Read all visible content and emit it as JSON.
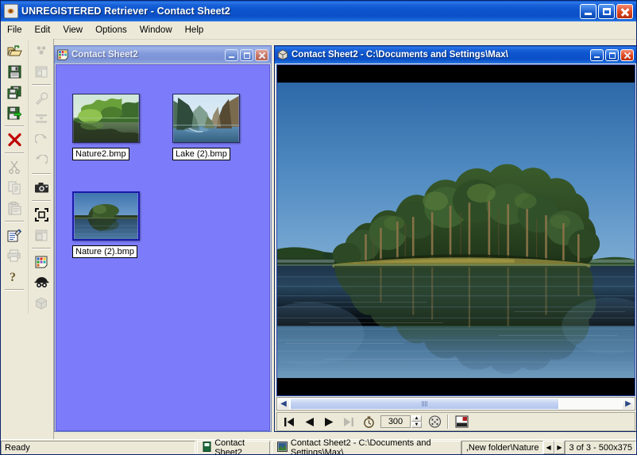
{
  "window": {
    "title": "UNREGISTERED Retriever - Contact Sheet2",
    "app_icon": "camera-lens-icon",
    "minimize_label": "Minimize",
    "maximize_label": "Maximize",
    "close_label": "Close"
  },
  "menu": {
    "items": [
      {
        "label": "File"
      },
      {
        "label": "Edit"
      },
      {
        "label": "View"
      },
      {
        "label": "Options"
      },
      {
        "label": "Window"
      },
      {
        "label": "Help"
      }
    ]
  },
  "toolbar_left": {
    "column1": [
      {
        "name": "open-folder-icon",
        "label": "Open",
        "enabled": true
      },
      {
        "name": "save-icon",
        "label": "Save",
        "enabled": true
      },
      {
        "name": "save-all-icon",
        "label": "Save All",
        "enabled": true
      },
      {
        "name": "save-export-icon",
        "label": "Export",
        "enabled": true
      },
      {
        "name": "delete-icon",
        "label": "Delete",
        "enabled": true
      },
      {
        "name": "cut-icon",
        "label": "Cut",
        "enabled": false
      },
      {
        "name": "copy-icon",
        "label": "Copy",
        "enabled": false
      },
      {
        "name": "paste-icon",
        "label": "Paste",
        "enabled": false
      },
      {
        "name": "properties-icon",
        "label": "Properties",
        "enabled": true
      },
      {
        "name": "print-icon",
        "label": "Print",
        "enabled": false
      },
      {
        "name": "help-icon",
        "label": "Help",
        "enabled": true
      }
    ],
    "column2": [
      {
        "name": "color-palette-icon",
        "label": "Colors",
        "enabled": false
      },
      {
        "name": "window-tile-icon",
        "label": "Tile Windows",
        "enabled": false
      },
      {
        "name": "wrench-icon",
        "label": "Tools",
        "enabled": false
      },
      {
        "name": "sort-icon",
        "label": "Sort",
        "enabled": false
      },
      {
        "name": "redo-icon",
        "label": "Redo",
        "enabled": false
      },
      {
        "name": "undo-icon",
        "label": "Undo",
        "enabled": false
      },
      {
        "name": "camera-icon",
        "label": "Capture",
        "enabled": true
      },
      {
        "name": "fullscreen-icon",
        "label": "Full Screen",
        "enabled": true
      },
      {
        "name": "cascade-windows-icon",
        "label": "Cascade",
        "enabled": false
      },
      {
        "name": "contact-sheet-icon",
        "label": "Contact Sheet",
        "enabled": true
      },
      {
        "name": "detective-icon",
        "label": "Find",
        "enabled": true
      },
      {
        "name": "cube-icon",
        "label": "3D",
        "enabled": false
      }
    ]
  },
  "contact_sheet_window": {
    "title": "Contact Sheet2",
    "icon": "contact-sheet-icon",
    "background_color": "#7c7cfb",
    "thumbnails": [
      {
        "caption": "Nature2.bmp",
        "selected": false,
        "scene": "river-forest"
      },
      {
        "caption": "Lake (2).bmp",
        "selected": false,
        "scene": "fjord-cliffs"
      },
      {
        "caption": "Nature (2).bmp",
        "selected": true,
        "scene": "lake-island"
      }
    ]
  },
  "image_window": {
    "title": "Contact Sheet2 - C:\\Documents and Settings\\Max\\",
    "icon": "cube-icon",
    "photo_alt": "lake-island-with-pine-trees-reflection",
    "scrollbar": {
      "left_arrow": "◀",
      "right_arrow": "▶",
      "thumb_position_percent": 0
    },
    "nav_toolbar": {
      "first_label": "First",
      "prev_label": "Previous",
      "next_label": "Next",
      "last_label": "Last",
      "timer_label": "Slideshow Timer",
      "interval_value": "300",
      "spin_up": "▲",
      "spin_down": "▼",
      "dice_label": "Random",
      "thumbnail_label": "Thumbnail View"
    }
  },
  "statusbar": {
    "ready_text": "Ready",
    "tasks": [
      {
        "label": "Contact Sheet2",
        "icon": "contact-sheet-icon"
      },
      {
        "label": "Contact Sheet2 - C:\\Documents and Settings\\Max\\",
        "icon": "image-icon"
      }
    ],
    "path_text": ",New folder\\Nature",
    "nav_prev": "◀",
    "nav_next": "▶",
    "info_text": "3 of 3 - 500x375"
  },
  "colors": {
    "titlebar_blue": "#0B50C8",
    "inactive_titlebar": "#8299da",
    "face": "#ece9d8",
    "sheet_bg": "#7c7cfb",
    "close_red": "#e04a22"
  }
}
